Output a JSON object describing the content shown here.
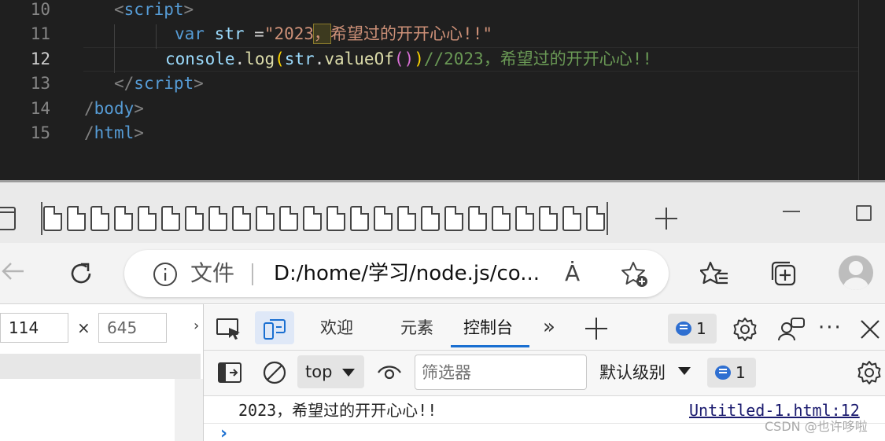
{
  "editor": {
    "lines": [
      {
        "num": "10",
        "open": "<",
        "tag": "script",
        "close": ">"
      },
      {
        "num": "11",
        "kw": "var",
        "var": "str",
        "eq": " =",
        "str_a": "\"2023",
        "str_comma": "，",
        "str_b": "希望过的开开心心!!\""
      },
      {
        "num": "12",
        "obj": "console",
        "dot1": ".",
        "fn": "log",
        "p1": "(",
        "arg": "str",
        "dot2": ".",
        "method": "valueOf",
        "p2": "(",
        "p3": ")",
        "p4": ")",
        "comment": "//2023，希望过的开开心心!!"
      },
      {
        "num": "13",
        "open": "</",
        "tag": "script",
        "close": ">"
      },
      {
        "num": "14",
        "open": "/",
        "tag": "body",
        "close": ">"
      },
      {
        "num": "15",
        "open": "/",
        "tag": "html",
        "close": ">"
      }
    ]
  },
  "browser": {
    "address_prefix": "文件",
    "address_url": "D:/home/学习/node.js/co...",
    "read_aloud": "Ȧ",
    "new_tab": "+"
  },
  "emulation": {
    "width_value": "114",
    "height_value": "645",
    "times": "×",
    "caret": "›"
  },
  "devtools": {
    "tabs": [
      "欢迎",
      "元素",
      "控制台"
    ],
    "active_tab": "控制台",
    "more": "»",
    "issues_count": "1",
    "dots": "···",
    "context": "top",
    "filter_placeholder": "筛选器",
    "levels": "默认级别",
    "console_issues_count": "1",
    "log_message": "2023，希望过的开开心心!!",
    "log_source": "Untitled-1.html:12",
    "prompt": "›"
  },
  "watermark": "CSDN @也许哆啦",
  "colors": {
    "editor_bg": "#1f1f1f",
    "tag": "#569cd6",
    "string": "#ce9178",
    "comment": "#6a9955",
    "function": "#dcdcaa",
    "variable": "#9cdcfe",
    "accent": "#1a6fd1"
  },
  "icons": [
    "window-icon",
    "back-arrow-icon",
    "refresh-icon",
    "info-icon",
    "read-aloud-icon",
    "favorite-add-icon",
    "favorites-icon",
    "collections-icon",
    "profile-icon",
    "inspect-icon",
    "device-toolbar-icon",
    "message-icon",
    "gear-icon",
    "people-icon",
    "close-icon",
    "sidebar-icon",
    "clear-icon",
    "eye-icon"
  ]
}
